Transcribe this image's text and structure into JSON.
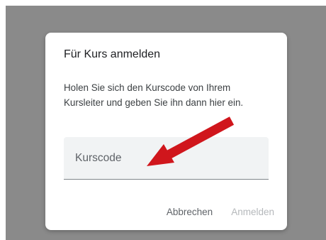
{
  "dialog": {
    "title": "Für Kurs anmelden",
    "description": "Holen Sie sich den Kurscode von Ihrem Kursleiter und geben Sie ihn dann hier ein.",
    "input": {
      "placeholder": "Kurscode",
      "value": ""
    },
    "cancel_label": "Abbrechen",
    "join_label": "Anmelden"
  },
  "annotation": {
    "arrow_color": "#d0161c",
    "icon": "red-arrow-icon"
  },
  "colors": {
    "backdrop": "#8a8a8a",
    "dialog": "#ffffff",
    "input_fill": "#f1f3f4"
  }
}
